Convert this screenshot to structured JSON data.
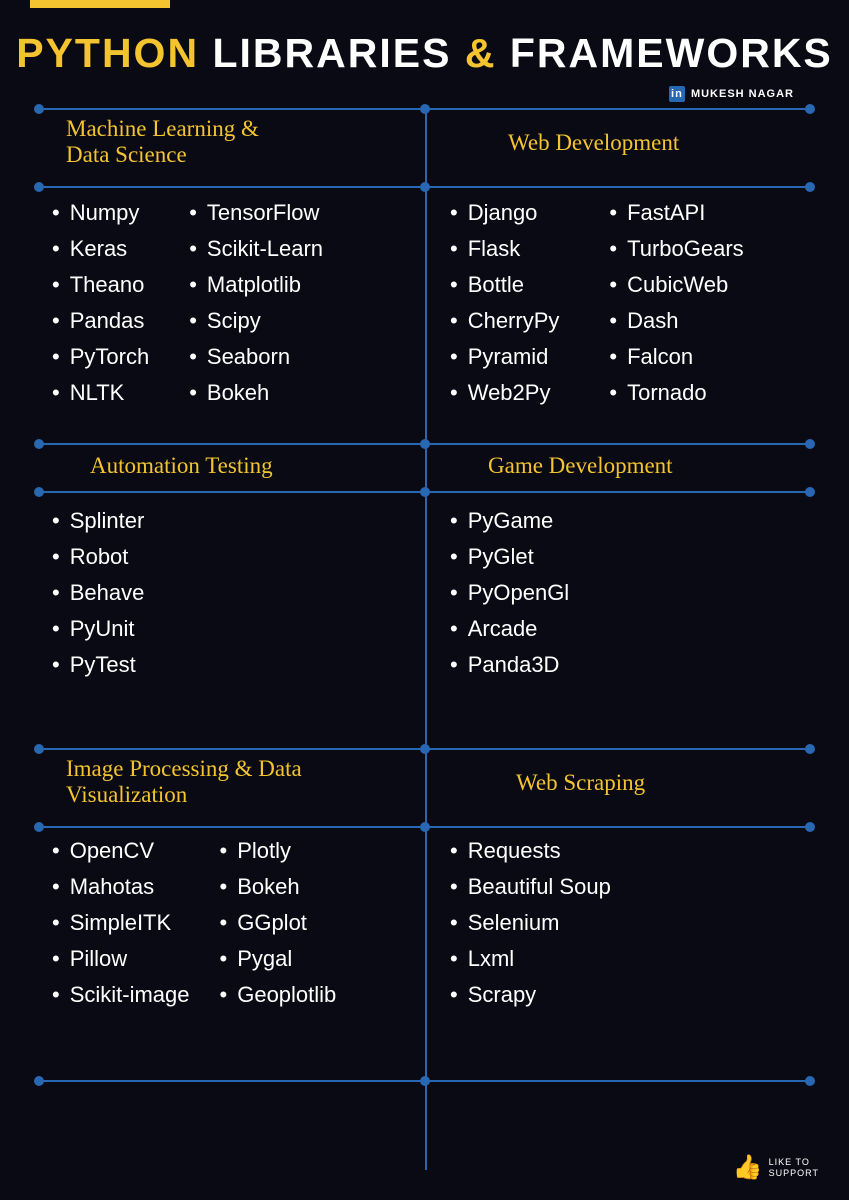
{
  "title": {
    "part1": "PYTHON",
    "part2": "LIBRARIES",
    "amp": "&",
    "part3": "FRAMEWORKS"
  },
  "author": "MUKESH NAGAR",
  "sections": {
    "ml": {
      "title": "Machine Learning &\nData Science",
      "col1": [
        "Numpy",
        "Keras",
        "Theano",
        "Pandas",
        "PyTorch",
        "NLTK"
      ],
      "col2": [
        "TensorFlow",
        "Scikit-Learn",
        "Matplotlib",
        "Scipy",
        "Seaborn",
        "Bokeh"
      ]
    },
    "web": {
      "title": "Web Development",
      "col1": [
        "Django",
        "Flask",
        "Bottle",
        "CherryPy",
        "Pyramid",
        "Web2Py"
      ],
      "col2": [
        "FastAPI",
        "TurboGears",
        "CubicWeb",
        "Dash",
        "Falcon",
        "Tornado"
      ]
    },
    "auto": {
      "title": "Automation Testing",
      "col1": [
        "Splinter",
        "Robot",
        "Behave",
        "PyUnit",
        "PyTest"
      ]
    },
    "game": {
      "title": "Game Development",
      "col1": [
        "PyGame",
        "PyGlet",
        "PyOpenGl",
        "Arcade",
        "Panda3D"
      ]
    },
    "img": {
      "title": "Image Processing & Data\nVisualization",
      "col1": [
        "OpenCV",
        "Mahotas",
        "SimpleITK",
        "Pillow",
        "Scikit-image"
      ],
      "col2": [
        "Plotly",
        "Bokeh",
        "GGplot",
        "Pygal",
        "Geoplotlib"
      ]
    },
    "scrape": {
      "title": "Web Scraping",
      "col1": [
        "Requests",
        "Beautiful Soup",
        "Selenium",
        "Lxml",
        "Scrapy"
      ]
    }
  },
  "like": {
    "line1": "LIKE TO",
    "line2": "SUPPORT"
  }
}
